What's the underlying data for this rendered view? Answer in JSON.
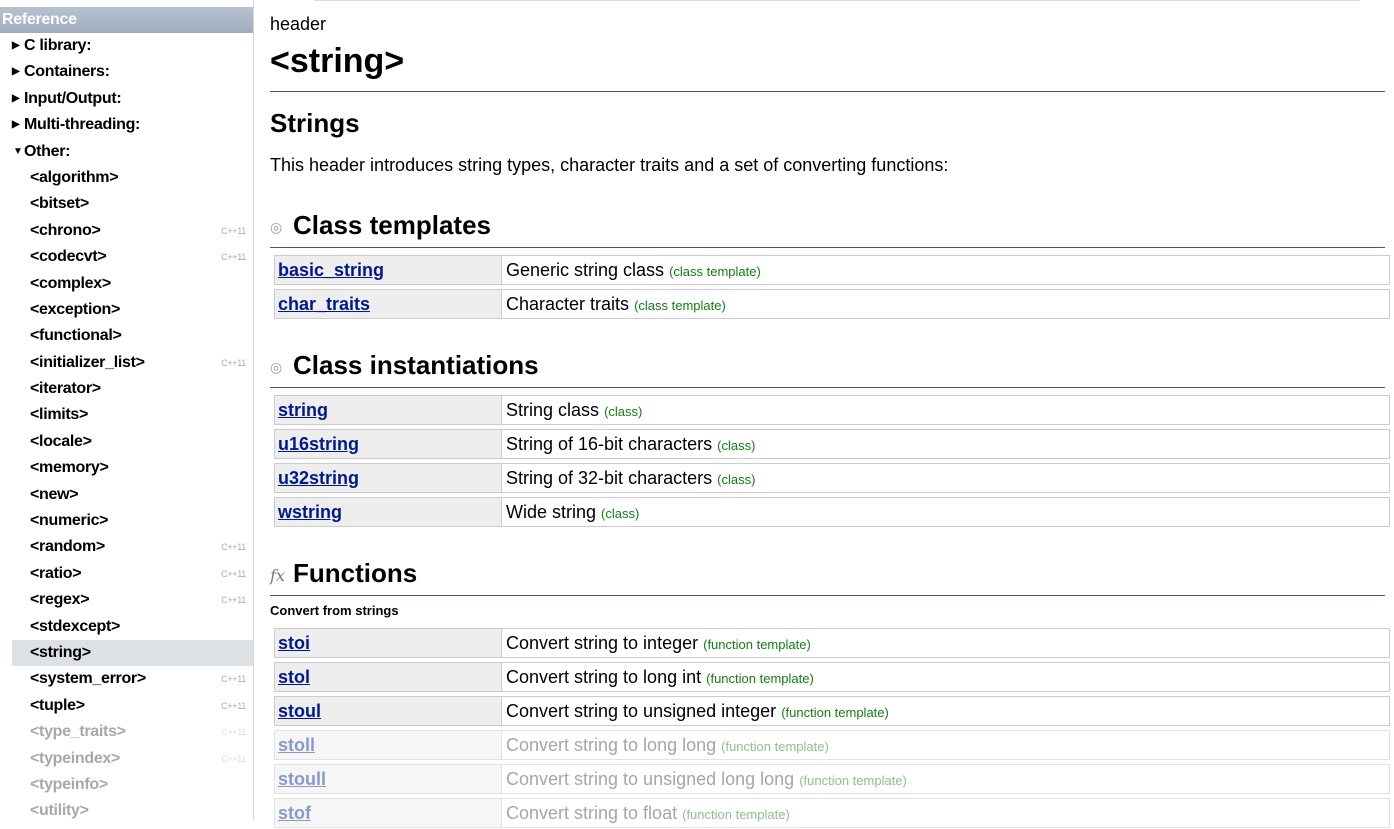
{
  "sidebar": {
    "title": "Reference",
    "categories": [
      {
        "label": "C library:",
        "open": false
      },
      {
        "label": "Containers:",
        "open": false
      },
      {
        "label": "Input/Output:",
        "open": false
      },
      {
        "label": "Multi-threading:",
        "open": false
      },
      {
        "label": "Other:",
        "open": true
      }
    ],
    "items": [
      {
        "label": "<algorithm>",
        "badge": ""
      },
      {
        "label": "<bitset>",
        "badge": ""
      },
      {
        "label": "<chrono>",
        "badge": "C++11"
      },
      {
        "label": "<codecvt>",
        "badge": "C++11"
      },
      {
        "label": "<complex>",
        "badge": ""
      },
      {
        "label": "<exception>",
        "badge": ""
      },
      {
        "label": "<functional>",
        "badge": ""
      },
      {
        "label": "<initializer_list>",
        "badge": "C++11"
      },
      {
        "label": "<iterator>",
        "badge": ""
      },
      {
        "label": "<limits>",
        "badge": ""
      },
      {
        "label": "<locale>",
        "badge": ""
      },
      {
        "label": "<memory>",
        "badge": ""
      },
      {
        "label": "<new>",
        "badge": ""
      },
      {
        "label": "<numeric>",
        "badge": ""
      },
      {
        "label": "<random>",
        "badge": "C++11"
      },
      {
        "label": "<ratio>",
        "badge": "C++11"
      },
      {
        "label": "<regex>",
        "badge": "C++11"
      },
      {
        "label": "<stdexcept>",
        "badge": ""
      },
      {
        "label": "<string>",
        "badge": ""
      },
      {
        "label": "<system_error>",
        "badge": "C++11"
      },
      {
        "label": "<tuple>",
        "badge": "C++11"
      },
      {
        "label": "<type_traits>",
        "badge": "C++11"
      },
      {
        "label": "<typeindex>",
        "badge": "C++11"
      },
      {
        "label": "<typeinfo>",
        "badge": ""
      },
      {
        "label": "<utility>",
        "badge": ""
      }
    ]
  },
  "page": {
    "crumb": "header",
    "title": "<string>",
    "heading": "Strings",
    "intro": "This header introduces string types, character traits and a set of converting functions:"
  },
  "sections": {
    "class_templates": {
      "title": "Class templates",
      "rows": [
        {
          "name": "basic_string",
          "desc": "Generic string class",
          "tag": "(class template)"
        },
        {
          "name": "char_traits",
          "desc": "Character traits",
          "tag": "(class template)"
        }
      ]
    },
    "class_instantiations": {
      "title": "Class instantiations",
      "rows": [
        {
          "name": "string",
          "desc": "String class",
          "tag": "(class)"
        },
        {
          "name": "u16string",
          "desc": "String of 16-bit characters",
          "tag": "(class)"
        },
        {
          "name": "u32string",
          "desc": "String of 32-bit characters",
          "tag": "(class)"
        },
        {
          "name": "wstring",
          "desc": "Wide string",
          "tag": "(class)"
        }
      ]
    },
    "functions": {
      "title": "Functions",
      "subhead": "Convert from strings",
      "rows": [
        {
          "name": "stoi",
          "desc": "Convert string to integer",
          "tag": "(function template)"
        },
        {
          "name": "stol",
          "desc": "Convert string to long int",
          "tag": "(function template)"
        },
        {
          "name": "stoul",
          "desc": "Convert string to unsigned integer",
          "tag": "(function template)"
        },
        {
          "name": "stoll",
          "desc": "Convert string to long long",
          "tag": "(function template)"
        },
        {
          "name": "stoull",
          "desc": "Convert string to unsigned long long",
          "tag": "(function template)"
        },
        {
          "name": "stof",
          "desc": "Convert string to float",
          "tag": "(function template)"
        }
      ]
    }
  },
  "colors": {
    "link": "#00188f",
    "tag_green": "#138012",
    "rule": "#475a75",
    "sidebar_title": "#9fadbf"
  }
}
